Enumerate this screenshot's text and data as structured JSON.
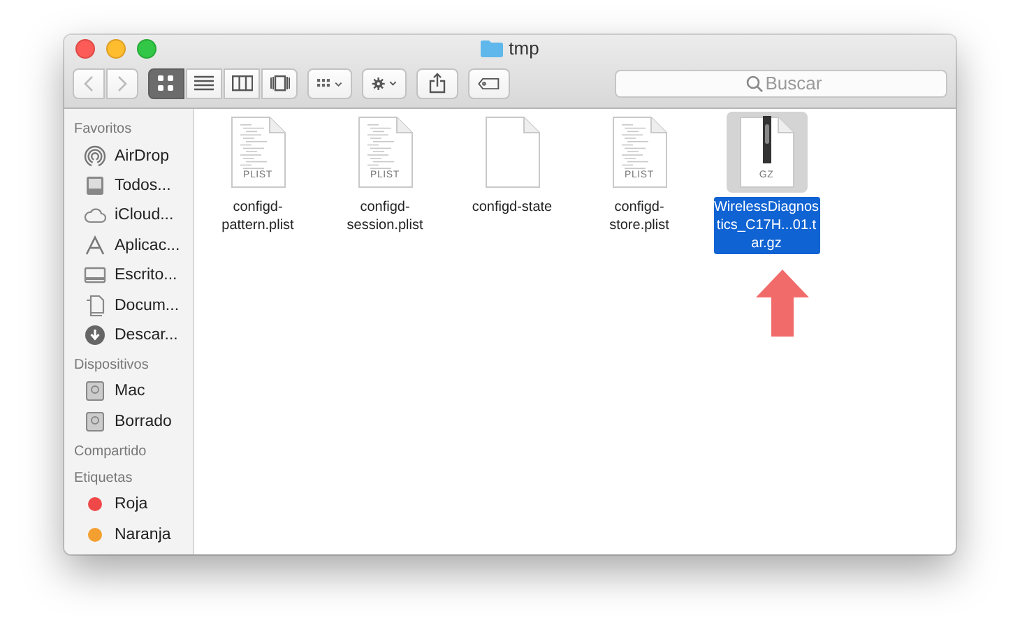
{
  "window": {
    "title": "tmp"
  },
  "toolbar": {
    "nav": [
      {
        "kind": "back",
        "disabled": true
      },
      {
        "kind": "forward",
        "disabled": true
      }
    ],
    "views": [
      {
        "kind": "icons",
        "selected": true
      },
      {
        "kind": "list",
        "selected": false
      },
      {
        "kind": "columns",
        "selected": false
      },
      {
        "kind": "coverflow",
        "selected": false
      }
    ],
    "buttons": [
      {
        "kind": "arrange"
      },
      {
        "kind": "action"
      },
      {
        "kind": "share"
      },
      {
        "kind": "tag"
      }
    ],
    "search": {
      "placeholder": "Buscar"
    }
  },
  "sidebar": {
    "sections": [
      {
        "title": "Favoritos",
        "items": [
          {
            "label": "AirDrop",
            "kind": "airdrop"
          },
          {
            "label": "Todos...",
            "kind": "allfiles"
          },
          {
            "label": "iCloud...",
            "kind": "cloud"
          },
          {
            "label": "Aplicac...",
            "kind": "apps"
          },
          {
            "label": "Escrito...",
            "kind": "desktop"
          },
          {
            "label": "Docum...",
            "kind": "documents"
          },
          {
            "label": "Descar...",
            "kind": "downloads"
          }
        ]
      },
      {
        "title": "Dispositivos",
        "items": [
          {
            "label": "Mac",
            "kind": "disk"
          },
          {
            "label": "Borrado",
            "kind": "disk"
          }
        ]
      },
      {
        "title": "Compartido"
      },
      {
        "title": "Etiquetas",
        "items": [
          {
            "label": "Roja",
            "kind": "tag",
            "color": "#f04848"
          },
          {
            "label": "Naranja",
            "kind": "tag",
            "color": "#f4a030"
          }
        ]
      }
    ]
  },
  "files": [
    {
      "name": "configd-pattern.plist",
      "kind": "text",
      "badge": "PLIST",
      "selected": false
    },
    {
      "name": "configd-session.plist",
      "kind": "text",
      "badge": "PLIST",
      "selected": false
    },
    {
      "name": "configd-state",
      "kind": "blank",
      "selected": false
    },
    {
      "name": "configd-store.plist",
      "kind": "text",
      "badge": "PLIST",
      "selected": false
    },
    {
      "name": "WirelessDiagnostics_C17H...01.tar.gz",
      "kind": "archive",
      "badge": "GZ",
      "selected": true
    }
  ]
}
